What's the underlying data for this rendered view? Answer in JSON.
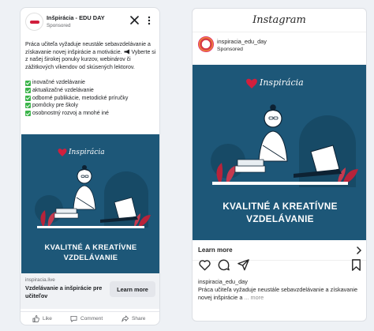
{
  "facebook": {
    "page_name": "Inšpirácia - EDU DAY",
    "sponsored": "Sponsored",
    "text_line_1": "Práca učiteľa vyžaduje neustále sebavzdelávanie a získavanie novej inšpirácie a motivácie.",
    "text_line_2": "Vyberte si z našej širokej ponuky kurzov, webinárov či zážitkových víkendov od skúsených lektorov.",
    "bullets": [
      "inovačné vzdelávanie",
      "aktualizačné vzdelávanie",
      "odborné publikácie, metodické príručky",
      "pomôcky pre školy",
      "osobnostný rozvoj a mnohé iné"
    ],
    "creative_logo": "Inspirácia",
    "creative_banner_line_1": "KVALITNÉ A KREATÍVNE",
    "creative_banner_line_2": "VZDELÁVANIE",
    "domain": "inspiracia.live",
    "headline": "Vzdelávanie a inšpirácie pre učiteľov",
    "cta": "Learn more",
    "actions": {
      "like": "Like",
      "comment": "Comment",
      "share": "Share"
    }
  },
  "instagram": {
    "wordmark": "Instagram",
    "username": "inspiracia_edu_day",
    "sponsored": "Sponsored",
    "creative_logo": "Inspirácia",
    "creative_banner_line_1": "KVALITNÉ A KREATÍVNE",
    "creative_banner_line_2": "VZDELÁVANIE",
    "learn_more": "Learn more",
    "caption_user": "inspiracia_edu_day",
    "caption_text": "Práca učiteľa vyžaduje neustále sebavzdelávanie a získavanie novej inšpirácie a",
    "caption_more": "... more"
  },
  "colors": {
    "creative_bg": "#1d5778",
    "accent_red": "#d11f3d",
    "check_green": "#3bb54a"
  },
  "icons": [
    "close-icon",
    "more-vertical-icon",
    "like-icon",
    "comment-icon",
    "share-icon",
    "heart-icon",
    "ig-comment-icon",
    "send-icon",
    "bookmark-icon",
    "chevron-right-icon",
    "megaphone-icon",
    "check-icon"
  ]
}
